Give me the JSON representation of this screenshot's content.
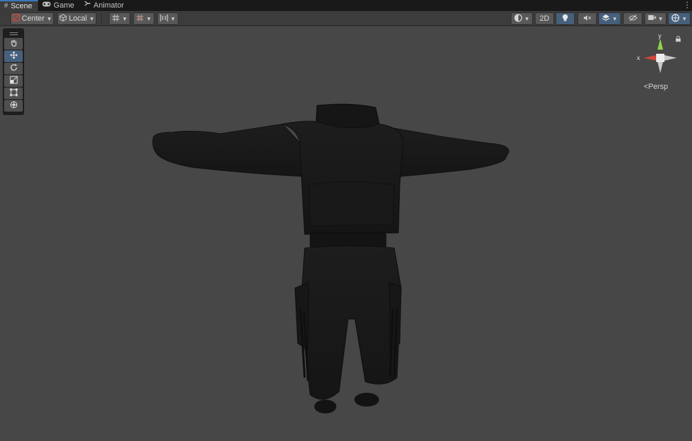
{
  "tabs": [
    {
      "label": "Scene",
      "icon": "grid-icon",
      "active": true
    },
    {
      "label": "Game",
      "icon": "gamepad-icon",
      "active": false
    },
    {
      "label": "Animator",
      "icon": "animator-icon",
      "active": false
    }
  ],
  "toolbar": {
    "pivot_label": "Center",
    "space_label": "Local",
    "view_2d_label": "2D"
  },
  "gizmo": {
    "y_label": "y",
    "x_label": "x",
    "projection_label": "Persp"
  },
  "colors": {
    "accent": "#46607c",
    "tab_highlight": "#3a79bb",
    "axis_x": "#d0463a",
    "axis_y": "#8fd34a",
    "background": "#474747"
  }
}
